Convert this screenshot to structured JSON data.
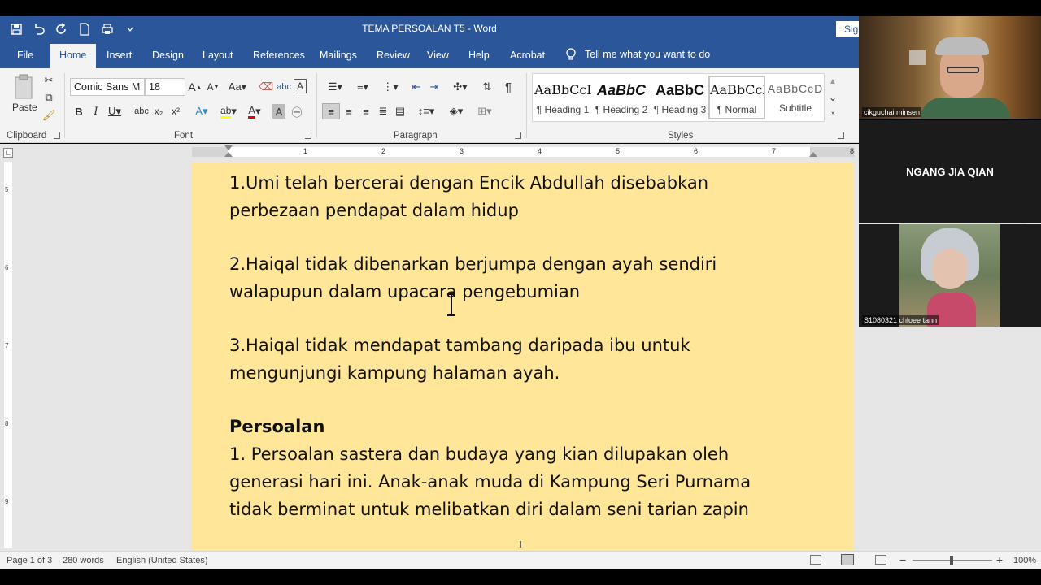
{
  "window": {
    "title": "TEMA PERSOALAN  T5  -  Word",
    "signin_label": "Sig"
  },
  "tabs": [
    {
      "label": "File"
    },
    {
      "label": "Home"
    },
    {
      "label": "Insert"
    },
    {
      "label": "Design"
    },
    {
      "label": "Layout"
    },
    {
      "label": "References"
    },
    {
      "label": "Mailings"
    },
    {
      "label": "Review"
    },
    {
      "label": "View"
    },
    {
      "label": "Help"
    },
    {
      "label": "Acrobat"
    }
  ],
  "tell_me": "Tell me what you want to do",
  "ribbon": {
    "clipboard": {
      "paste_label": "Paste",
      "group_label": "Clipboard"
    },
    "font": {
      "family": "Comic Sans M",
      "size": "18",
      "group_label": "Font"
    },
    "paragraph": {
      "group_label": "Paragraph"
    },
    "styles": {
      "group_label": "Styles",
      "items": [
        {
          "preview": "AaBbCcI",
          "name": "¶ Heading 1"
        },
        {
          "preview": "AaBbC",
          "name": "¶ Heading 2"
        },
        {
          "preview": "AaBbC",
          "name": "¶ Heading 3"
        },
        {
          "preview": "AaBbCcI",
          "name": "¶ Normal"
        },
        {
          "preview": "AaBbCcD",
          "name": "Subtitle"
        }
      ]
    }
  },
  "document": {
    "lines": [
      "1.Umi telah bercerai dengan Encik Abdullah disebabkan",
      "perbezaan pendapat dalam hidup",
      "2.Haiqal tidak dibenarkan berjumpa dengan ayah sendiri",
      "walapupun dalam upacara pengebumian",
      "3.Haiqal tidak mendapat tambang daripada ibu untuk",
      "mengunjungi kampung halaman ayah.",
      "Persoalan",
      "1. Persoalan sastera dan budaya yang kian dilupakan oleh",
      "generasi hari ini. Anak-anak muda di Kampung Seri Purnama",
      "tidak berminat untuk melibatkan diri dalam seni tarian zapin"
    ],
    "page_color": "#ffe699"
  },
  "ruler": {
    "h_numbers": [
      "1",
      "2",
      "3",
      "4",
      "5",
      "6",
      "7",
      "8"
    ],
    "v_numbers": [
      "5",
      "6",
      "7",
      "8",
      "9"
    ]
  },
  "status": {
    "page": "Page 1 of 3",
    "words": "280 words",
    "language": "English (United States)",
    "zoom": "100%"
  },
  "participants": [
    {
      "name": "cikguchai minsen"
    },
    {
      "name": "NGANG JIA QIAN"
    },
    {
      "name": "S1080321 chloee tann"
    }
  ],
  "colors": {
    "accent": "#2b579a"
  }
}
